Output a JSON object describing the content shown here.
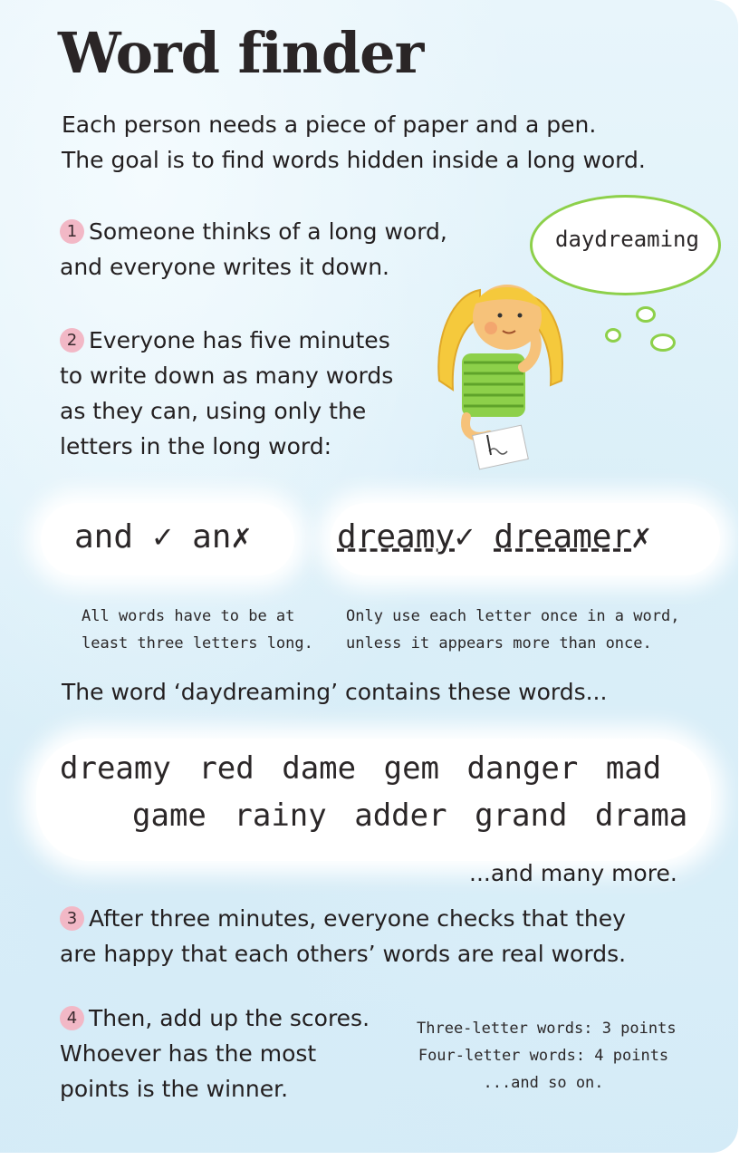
{
  "title": "Word finder",
  "intro": [
    "Each person needs a piece of paper and a pen.",
    "The goal is to find words hidden inside a long word."
  ],
  "steps": [
    {
      "num": "1",
      "lines": [
        "Someone thinks of a long word,",
        "and everyone writes it down."
      ]
    },
    {
      "num": "2",
      "lines": [
        "Everyone has five minutes",
        "to write down as many words",
        "as they can, using only the",
        "letters in the long word:"
      ]
    },
    {
      "num": "3",
      "lines": [
        "After three minutes, everyone checks that they",
        "are happy that each others’ words are real words."
      ]
    },
    {
      "num": "4",
      "lines": [
        "Then, add up the scores.",
        "Whoever has the most",
        "points is the winner."
      ]
    }
  ],
  "thought_bubble": "daydreaming",
  "examples": {
    "left": [
      {
        "word": "and",
        "mark": "✓",
        "mark_type": "tick"
      },
      {
        "word": "an",
        "mark": "✗",
        "mark_type": "cross"
      }
    ],
    "right": [
      {
        "word": "dreamy",
        "mark": "✓",
        "mark_type": "tick"
      },
      {
        "word": "dreamer",
        "mark": "✗",
        "mark_type": "cross"
      }
    ]
  },
  "rules": {
    "left": [
      "All words have to be at",
      "least three letters long."
    ],
    "right": [
      "Only use each letter once in a word,",
      "unless it appears more than once."
    ]
  },
  "contains_heading": "The word ‘daydreaming’ contains these words...",
  "word_list": {
    "row1": [
      "dreamy",
      "red",
      "dame",
      "gem",
      "danger",
      "mad"
    ],
    "row2": [
      "game",
      "rainy",
      "adder",
      "grand",
      "drama"
    ]
  },
  "and_many_more": "...and many more.",
  "scoring": [
    "Three-letter words: 3 points",
    "Four-letter words: 4 points",
    "...and so on."
  ],
  "colors": {
    "accent_green": "#8dd04a",
    "number_badge": "#f2b8c6",
    "background": "#dcf0f9"
  }
}
